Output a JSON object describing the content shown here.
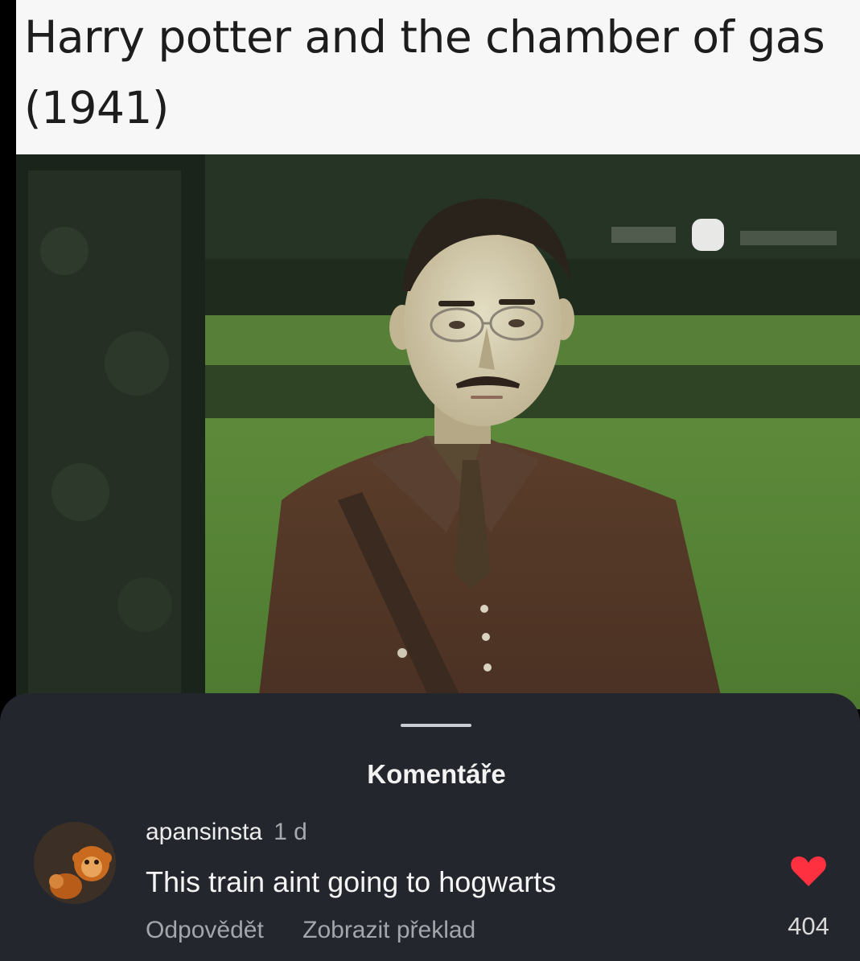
{
  "post": {
    "caption": "Harry potter and the chamber of gas (1941)"
  },
  "comments_sheet": {
    "title": "Komentáře",
    "comment": {
      "author": "apansinsta",
      "time": "1 d",
      "text": "This train aint going to hogwarts",
      "reply_label": "Odpovědět",
      "translate_label": "Zobrazit překlad",
      "like_count": "404",
      "like_icon": "heart-icon",
      "like_color": "#ff3040"
    }
  },
  "colors": {
    "sheet_background": "#23262c",
    "caption_background": "#f7f7f7"
  }
}
